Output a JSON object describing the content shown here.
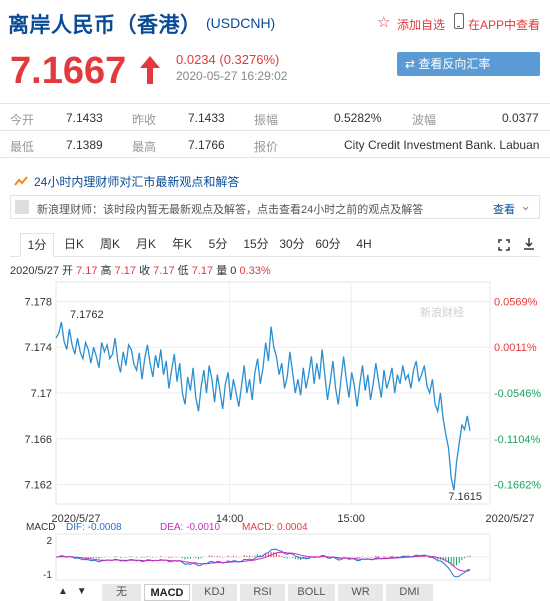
{
  "header": {
    "title": "离岸人民币（香港）",
    "code": "(USDCNH)",
    "add_fav": "添加自选",
    "app_link": "在APP中查看"
  },
  "quote": {
    "price": "7.1667",
    "change": "0.0234 (0.3276%)",
    "timestamp": "2020-05-27 16:29:02",
    "reverse_button": "⇄ 查看反向汇率 CNHUSD"
  },
  "stats": [
    [
      {
        "label": "今开",
        "value": "7.1433"
      },
      {
        "label": "昨收",
        "value": "7.1433"
      },
      {
        "label": "振幅",
        "value": "0.5282%"
      },
      {
        "label": "波幅",
        "value": "0.0377"
      }
    ],
    [
      {
        "label": "最低",
        "value": "7.1389"
      },
      {
        "label": "最高",
        "value": "7.1766"
      },
      {
        "label": "报价",
        "value": "City Credit Investment Bank. Labuan"
      }
    ]
  ],
  "news": {
    "header": "24小时内理财师对汇市最新观点和解答",
    "text": "新浪理财师：该时段内暂无最新观点及解答，点击查看24小时之前的观点及解答",
    "more": "查看"
  },
  "tabs": [
    "1分",
    "日K",
    "周K",
    "月K",
    "年K",
    "5分",
    "15分",
    "30分",
    "60分",
    "4H"
  ],
  "info_line": {
    "date": "2020/5/27",
    "open_label": "开",
    "open": "7.17",
    "high_label": "高",
    "high": "7.17",
    "close_label": "收",
    "close": "7.17",
    "low_label": "低",
    "low": "7.17",
    "vol_label": "量",
    "vol": "0",
    "pct": "0.33%"
  },
  "chart_data": {
    "type": "line",
    "y_ticks": [
      "7.178",
      "7.174",
      "7.17",
      "7.166",
      "7.162"
    ],
    "y_values": [
      7.178,
      7.174,
      7.17,
      7.166,
      7.162
    ],
    "pct_ticks": [
      "0.0569%",
      "0.0011%",
      "-0.0546%",
      "-0.1104%",
      "-0.1662%"
    ],
    "ylim": [
      7.161,
      7.179
    ],
    "x_labels": [
      "2020/5/27",
      "14:00",
      "15:00",
      "2020/5/27"
    ],
    "max_label": "7.1762",
    "min_label": "7.1615",
    "watermark": "新浪财经",
    "series": [
      {
        "values": [
          7.1748,
          7.1752,
          7.1762,
          7.1745,
          7.1738,
          7.1756,
          7.1742,
          7.1734,
          7.1748,
          7.1736,
          7.173,
          7.1744,
          7.1738,
          7.1726,
          7.174,
          7.1732,
          7.1722,
          7.1744,
          7.1736,
          7.1742,
          7.173,
          7.1734,
          7.1748,
          7.1728,
          7.1718,
          7.1736,
          7.1724,
          7.1742,
          7.1738,
          7.1725,
          7.172,
          7.1735,
          7.1712,
          7.173,
          7.1742,
          7.1726,
          7.1714,
          7.1733,
          7.1722,
          7.1738,
          7.1716,
          7.1728,
          7.1704,
          7.172,
          7.1734,
          7.171,
          7.1726,
          7.17,
          7.169,
          7.1714,
          7.1702,
          7.1722,
          7.1696,
          7.1684,
          7.1706,
          7.172,
          7.17,
          7.1724,
          7.1712,
          7.1692,
          7.1716,
          7.1702,
          7.1686,
          7.1708,
          7.1718,
          7.1694,
          7.1712,
          7.17,
          7.1688,
          7.1706,
          7.1724,
          7.17,
          7.1712,
          7.1694,
          7.1718,
          7.173,
          7.1708,
          7.1722,
          7.1744,
          7.1728,
          7.1758,
          7.174,
          7.1732,
          7.1716,
          7.1726,
          7.1704,
          7.1714,
          7.1736,
          7.1718,
          7.17,
          7.1712,
          7.1698,
          7.1722,
          7.1704,
          7.1716,
          7.1732,
          7.1708,
          7.1726,
          7.1712,
          7.1738,
          7.1716,
          7.1694,
          7.171,
          7.1728,
          7.1704,
          7.169,
          7.1712,
          7.1732,
          7.1712,
          7.1696,
          7.1718,
          7.1706,
          7.1688,
          7.1708,
          7.1724,
          7.1702,
          7.1716,
          7.1694,
          7.1708,
          7.1726,
          7.171,
          7.1696,
          7.172,
          7.1704,
          7.1712,
          7.1722,
          7.17,
          7.1716,
          7.1708,
          7.1724,
          7.1712,
          7.1716,
          7.1704,
          7.172,
          7.1728,
          7.171,
          7.1716,
          7.1724,
          7.1706,
          7.17,
          7.1712,
          7.169,
          7.1684,
          7.17,
          7.1678,
          7.1664,
          7.1652,
          7.1626,
          7.1615,
          7.164,
          7.1656,
          7.1672,
          7.1668,
          7.168,
          7.1667
        ]
      }
    ]
  },
  "macd": {
    "label": "MACD",
    "dif": "DIF: -0.0008",
    "dea": "DEA: -0.0010",
    "macd": "MACD: 0.0004",
    "ticks": [
      "2",
      "-1"
    ]
  },
  "bottom_tabs": [
    "无",
    "MACD",
    "KDJ",
    "RSI",
    "BOLL",
    "WR",
    "DMI"
  ],
  "colors": {
    "brand_blue": "#0a4b96",
    "up_red": "#e4393c",
    "down_green": "#1aa260",
    "line_blue": "#2a8fd0"
  }
}
